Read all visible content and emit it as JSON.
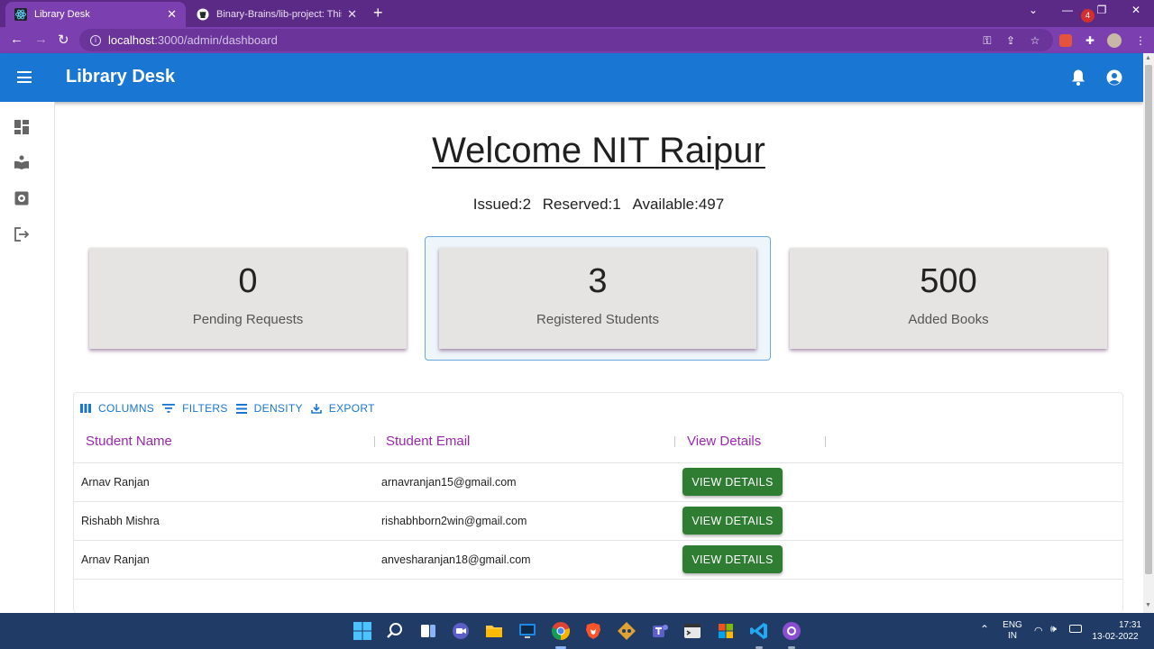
{
  "browser": {
    "tabs": [
      {
        "title": "Library Desk",
        "active": true
      },
      {
        "title": "Binary-Brains/lib-project: This Pr",
        "active": false
      }
    ],
    "url_host": "localhost",
    "url_path": ":3000/admin/dashboard"
  },
  "appbar": {
    "title": "Library Desk",
    "notification_count": "4"
  },
  "sidebar": {
    "items": [
      {
        "icon": "dashboard-icon"
      },
      {
        "icon": "reader-icon"
      },
      {
        "icon": "settings-icon"
      },
      {
        "icon": "logout-icon"
      }
    ]
  },
  "main": {
    "heading": "Welcome NIT Raipur",
    "summary": {
      "issued": "Issued:2",
      "reserved": "Reserved:1",
      "available": "Available:497"
    },
    "cards": [
      {
        "value": "0",
        "label": "Pending Requests"
      },
      {
        "value": "3",
        "label": "Registered Students"
      },
      {
        "value": "500",
        "label": "Added Books"
      }
    ]
  },
  "grid": {
    "toolbar": {
      "columns": "COLUMNS",
      "filters": "FILTERS",
      "density": "DENSITY",
      "export": "EXPORT"
    },
    "headers": [
      "Student Name",
      "Student Email",
      "View Details"
    ],
    "rows": [
      {
        "name": "Arnav Ranjan",
        "email": "arnavranjan15@gmail.com",
        "action": "VIEW DETAILS"
      },
      {
        "name": "Rishabh Mishra",
        "email": "rishabhborn2win@gmail.com",
        "action": "VIEW DETAILS"
      },
      {
        "name": "Arnav Ranjan",
        "email": "anvesharanjan18@gmail.com",
        "action": "VIEW DETAILS"
      }
    ]
  },
  "taskbar": {
    "lang": "ENG",
    "region": "IN",
    "time": "17:31",
    "date": "13-02-2022"
  },
  "colors": {
    "appbar": "#1976d2",
    "header_text": "#9c27b0",
    "view_button": "#2e7d32",
    "browser_frame": "#5b2a86"
  }
}
